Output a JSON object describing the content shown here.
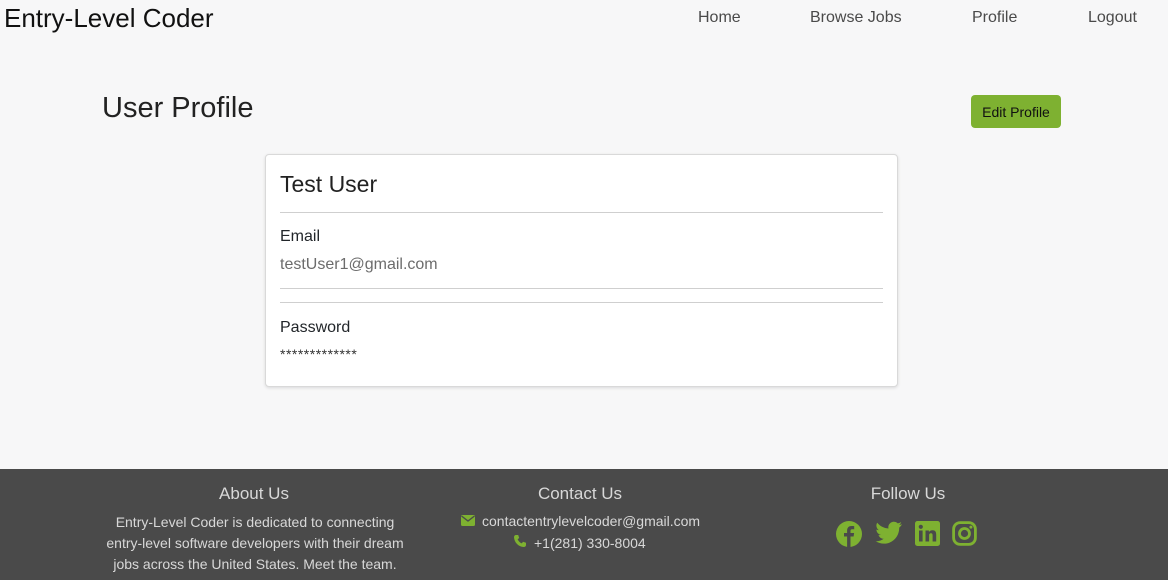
{
  "header": {
    "brand": "Entry-Level Coder",
    "nav": [
      "Home",
      "Browse Jobs",
      "Profile",
      "Logout"
    ]
  },
  "page": {
    "title": "User Profile",
    "edit_button": "Edit Profile"
  },
  "profile": {
    "name": "Test User",
    "email_label": "Email",
    "email_value": "testUser1@gmail.com",
    "password_label": "Password",
    "password_value": "*************"
  },
  "footer": {
    "about_title": "About Us",
    "about_text": "Entry-Level Coder is dedicated to connecting entry-level software developers with their dream jobs across the United States. Meet the team.",
    "contact_title": "Contact Us",
    "contact_email": "contactentrylevelcoder@gmail.com",
    "contact_phone": "+1(281) 330-8004",
    "follow_title": "Follow Us",
    "social_icons": [
      "facebook-icon",
      "twitter-icon",
      "linkedin-icon",
      "instagram-icon"
    ]
  },
  "colors": {
    "accent": "#7eb131",
    "footer_bg": "#4a4a4a"
  }
}
